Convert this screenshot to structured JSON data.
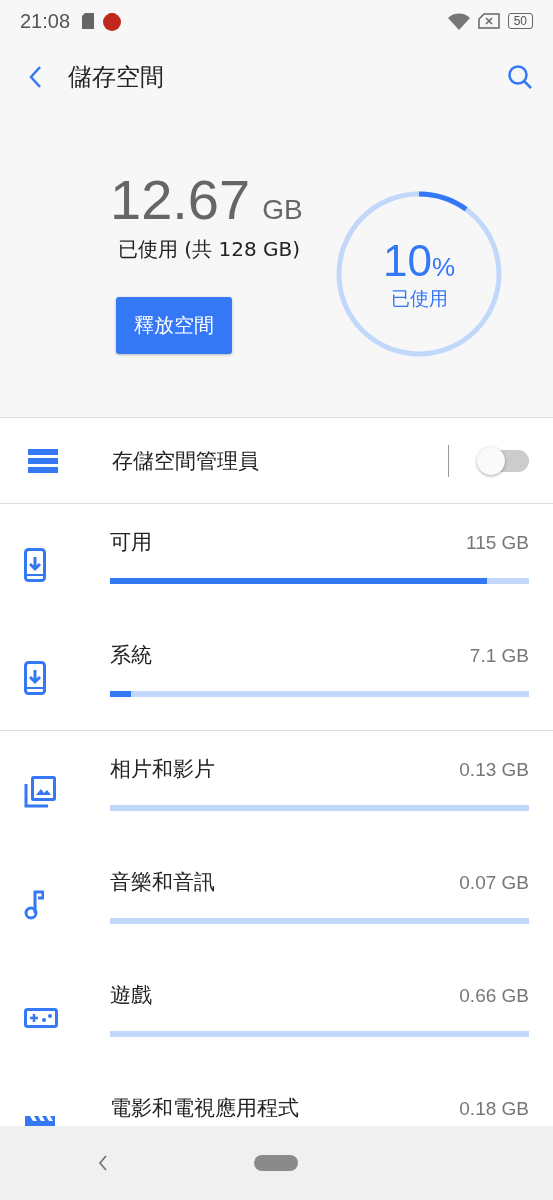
{
  "status_bar": {
    "time": "21:08",
    "battery": "50"
  },
  "toolbar": {
    "title": "儲存空間"
  },
  "summary": {
    "used_amount": "12.67",
    "used_unit": "GB",
    "used_caption": "已使用 (共 128 GB)",
    "free_button": "釋放空間",
    "ring": {
      "percent": "10",
      "percent_unit": "%",
      "caption": "已使用"
    }
  },
  "manager": {
    "label": "存儲空間管理員",
    "on": false
  },
  "groups": [
    {
      "items": [
        {
          "kind": "download",
          "label": "可用",
          "size": "115 GB",
          "level": 0.9
        },
        {
          "kind": "download",
          "label": "系統",
          "size": "7.1 GB",
          "level": 0.05
        }
      ]
    },
    {
      "items": [
        {
          "kind": "photos",
          "label": "相片和影片",
          "size": "0.13 GB",
          "level": 0
        },
        {
          "kind": "music",
          "label": "音樂和音訊",
          "size": "0.07 GB",
          "level": 0
        },
        {
          "kind": "games",
          "label": "遊戲",
          "size": "0.66 GB",
          "level": 0
        },
        {
          "kind": "movies",
          "label": "電影和電視應用程式",
          "size": "0.18 GB"
        }
      ]
    }
  ]
}
